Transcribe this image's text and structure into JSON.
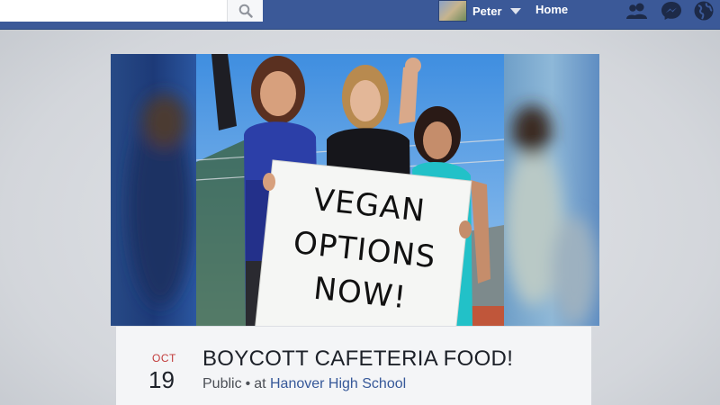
{
  "topbar": {
    "search_placeholder": "",
    "user_name": "Peter",
    "home_label": "Home",
    "icons": [
      "search-icon",
      "friend-requests-icon",
      "messenger-icon",
      "notifications-globe-icon"
    ],
    "brand_color": "#3b5998"
  },
  "event": {
    "month": "OCT",
    "day": "19",
    "title": "BOYCOTT CAFETERIA FOOD!",
    "privacy": "Public",
    "separator": "•",
    "at_label": "at",
    "location": "Hanover High School",
    "cover_sign": [
      "VEGAN",
      "OPTIONS",
      "NOW!"
    ]
  }
}
